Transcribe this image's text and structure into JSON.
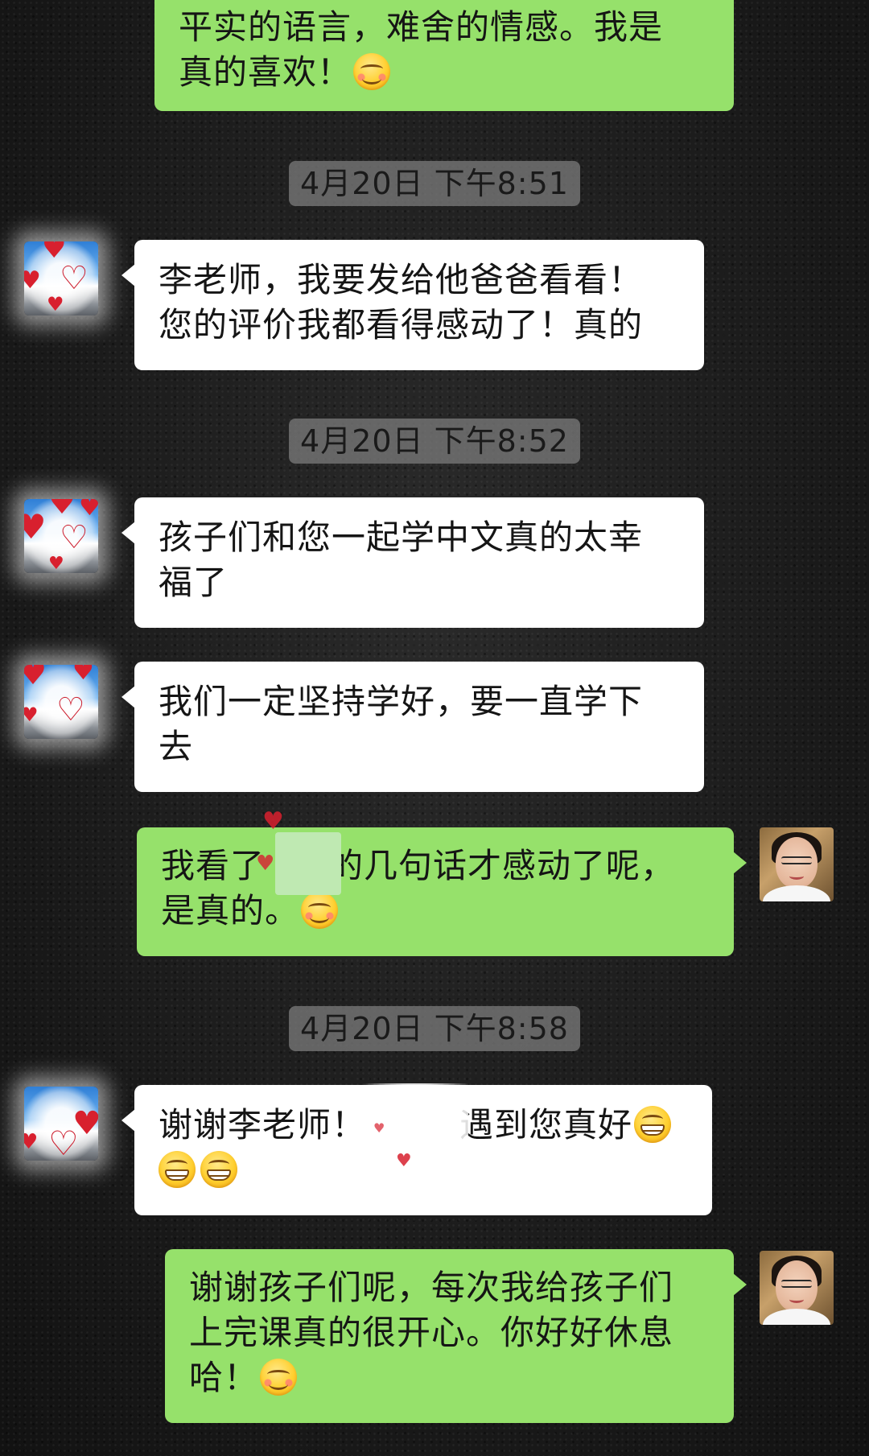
{
  "messages": [
    {
      "direction": "out",
      "lines": [
        "平实的语言，难舍的情感。我是",
        "真的喜欢！"
      ],
      "emoji": "smile"
    },
    {
      "timestamp": "4月20日 下午8:51"
    },
    {
      "direction": "in",
      "lines": [
        "李老师，我要发给他爸爸看看！",
        "您的评价我都看得感动了！真的"
      ]
    },
    {
      "timestamp": "4月20日 下午8:52"
    },
    {
      "direction": "in",
      "lines": [
        "孩子们和您一起学中文真的太幸",
        "福了"
      ]
    },
    {
      "direction": "in",
      "lines": [
        "我们一定坚持学好，要一直学下",
        "去"
      ]
    },
    {
      "direction": "out",
      "lines_parts": [
        "我看了",
        "的几句话才感动了呢，",
        "是真的。"
      ],
      "emoji": "smile"
    },
    {
      "timestamp": "4月20日 下午8:58"
    },
    {
      "direction": "in",
      "lines_parts": [
        "谢谢李老师！",
        "遇到您真好"
      ],
      "emoji": "grin"
    },
    {
      "direction": "out",
      "lines": [
        "谢谢孩子们呢，每次我给孩子们",
        "上完课真的很开心。你好好休息",
        "哈！"
      ],
      "emoji": "smile"
    }
  ],
  "icons": {
    "smile_emoji": "smiling-face-emoji",
    "grin_emoji": "grinning-face-emoji",
    "heart": "heart"
  },
  "colors": {
    "outgoing_bubble": "#96e16b",
    "incoming_bubble": "#ffffff",
    "timestamp_bg": "#787878",
    "background": "#1c1c1c"
  }
}
